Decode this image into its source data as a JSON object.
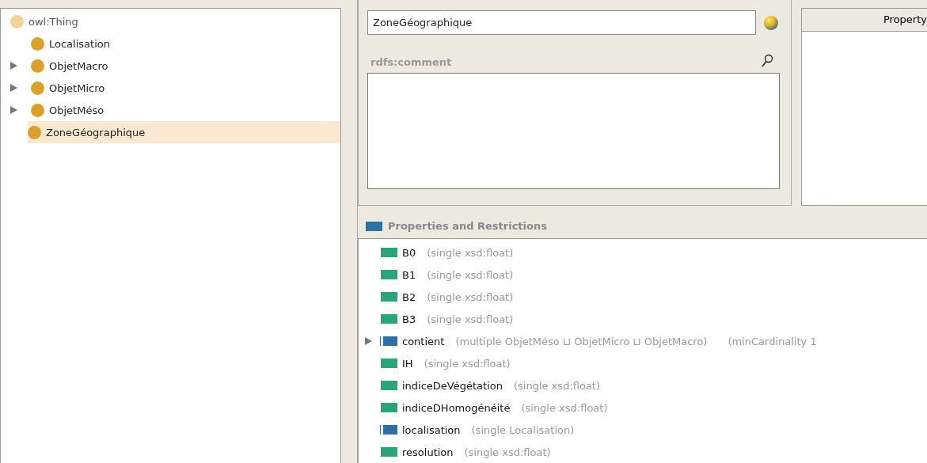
{
  "class_tree": {
    "root": {
      "label": "owl:Thing",
      "children": [
        {
          "label": "Localisation",
          "expandable": false,
          "selected": false
        },
        {
          "label": "ObjetMacro",
          "expandable": true,
          "selected": false
        },
        {
          "label": "ObjetMicro",
          "expandable": true,
          "selected": false
        },
        {
          "label": "ObjetMéso",
          "expandable": true,
          "selected": false
        },
        {
          "label": "ZoneGéographique",
          "expandable": false,
          "selected": true
        }
      ]
    }
  },
  "annotations": {
    "name_value": "ZoneGéographique",
    "comment_label": "rdfs:comment"
  },
  "property_table": {
    "header": "Property"
  },
  "properties": {
    "title": "Properties and Restrictions",
    "rows": [
      {
        "kind": "data",
        "expandable": false,
        "name": "B0",
        "range": "(single xsd:float)"
      },
      {
        "kind": "data",
        "expandable": false,
        "name": "B1",
        "range": "(single xsd:float)"
      },
      {
        "kind": "data",
        "expandable": false,
        "name": "B2",
        "range": "(single xsd:float)"
      },
      {
        "kind": "data",
        "expandable": false,
        "name": "B3",
        "range": "(single xsd:float)"
      },
      {
        "kind": "object",
        "expandable": true,
        "name": "contient",
        "range": "(multiple ObjetMéso ⊔ ObjetMicro ⊔ ObjetMacro)",
        "restriction": "(minCardinality 1"
      },
      {
        "kind": "data",
        "expandable": false,
        "name": "IH",
        "range": "(single xsd:float)"
      },
      {
        "kind": "data",
        "expandable": false,
        "name": "indiceDeVégétation",
        "range": "(single xsd:float)"
      },
      {
        "kind": "data",
        "expandable": false,
        "name": "indiceDHomogénéité",
        "range": "(single xsd:float)"
      },
      {
        "kind": "object",
        "expandable": false,
        "name": "localisation",
        "range": "(single Localisation)"
      },
      {
        "kind": "data",
        "expandable": false,
        "name": "resolution",
        "range": "(single xsd:float)"
      }
    ]
  }
}
